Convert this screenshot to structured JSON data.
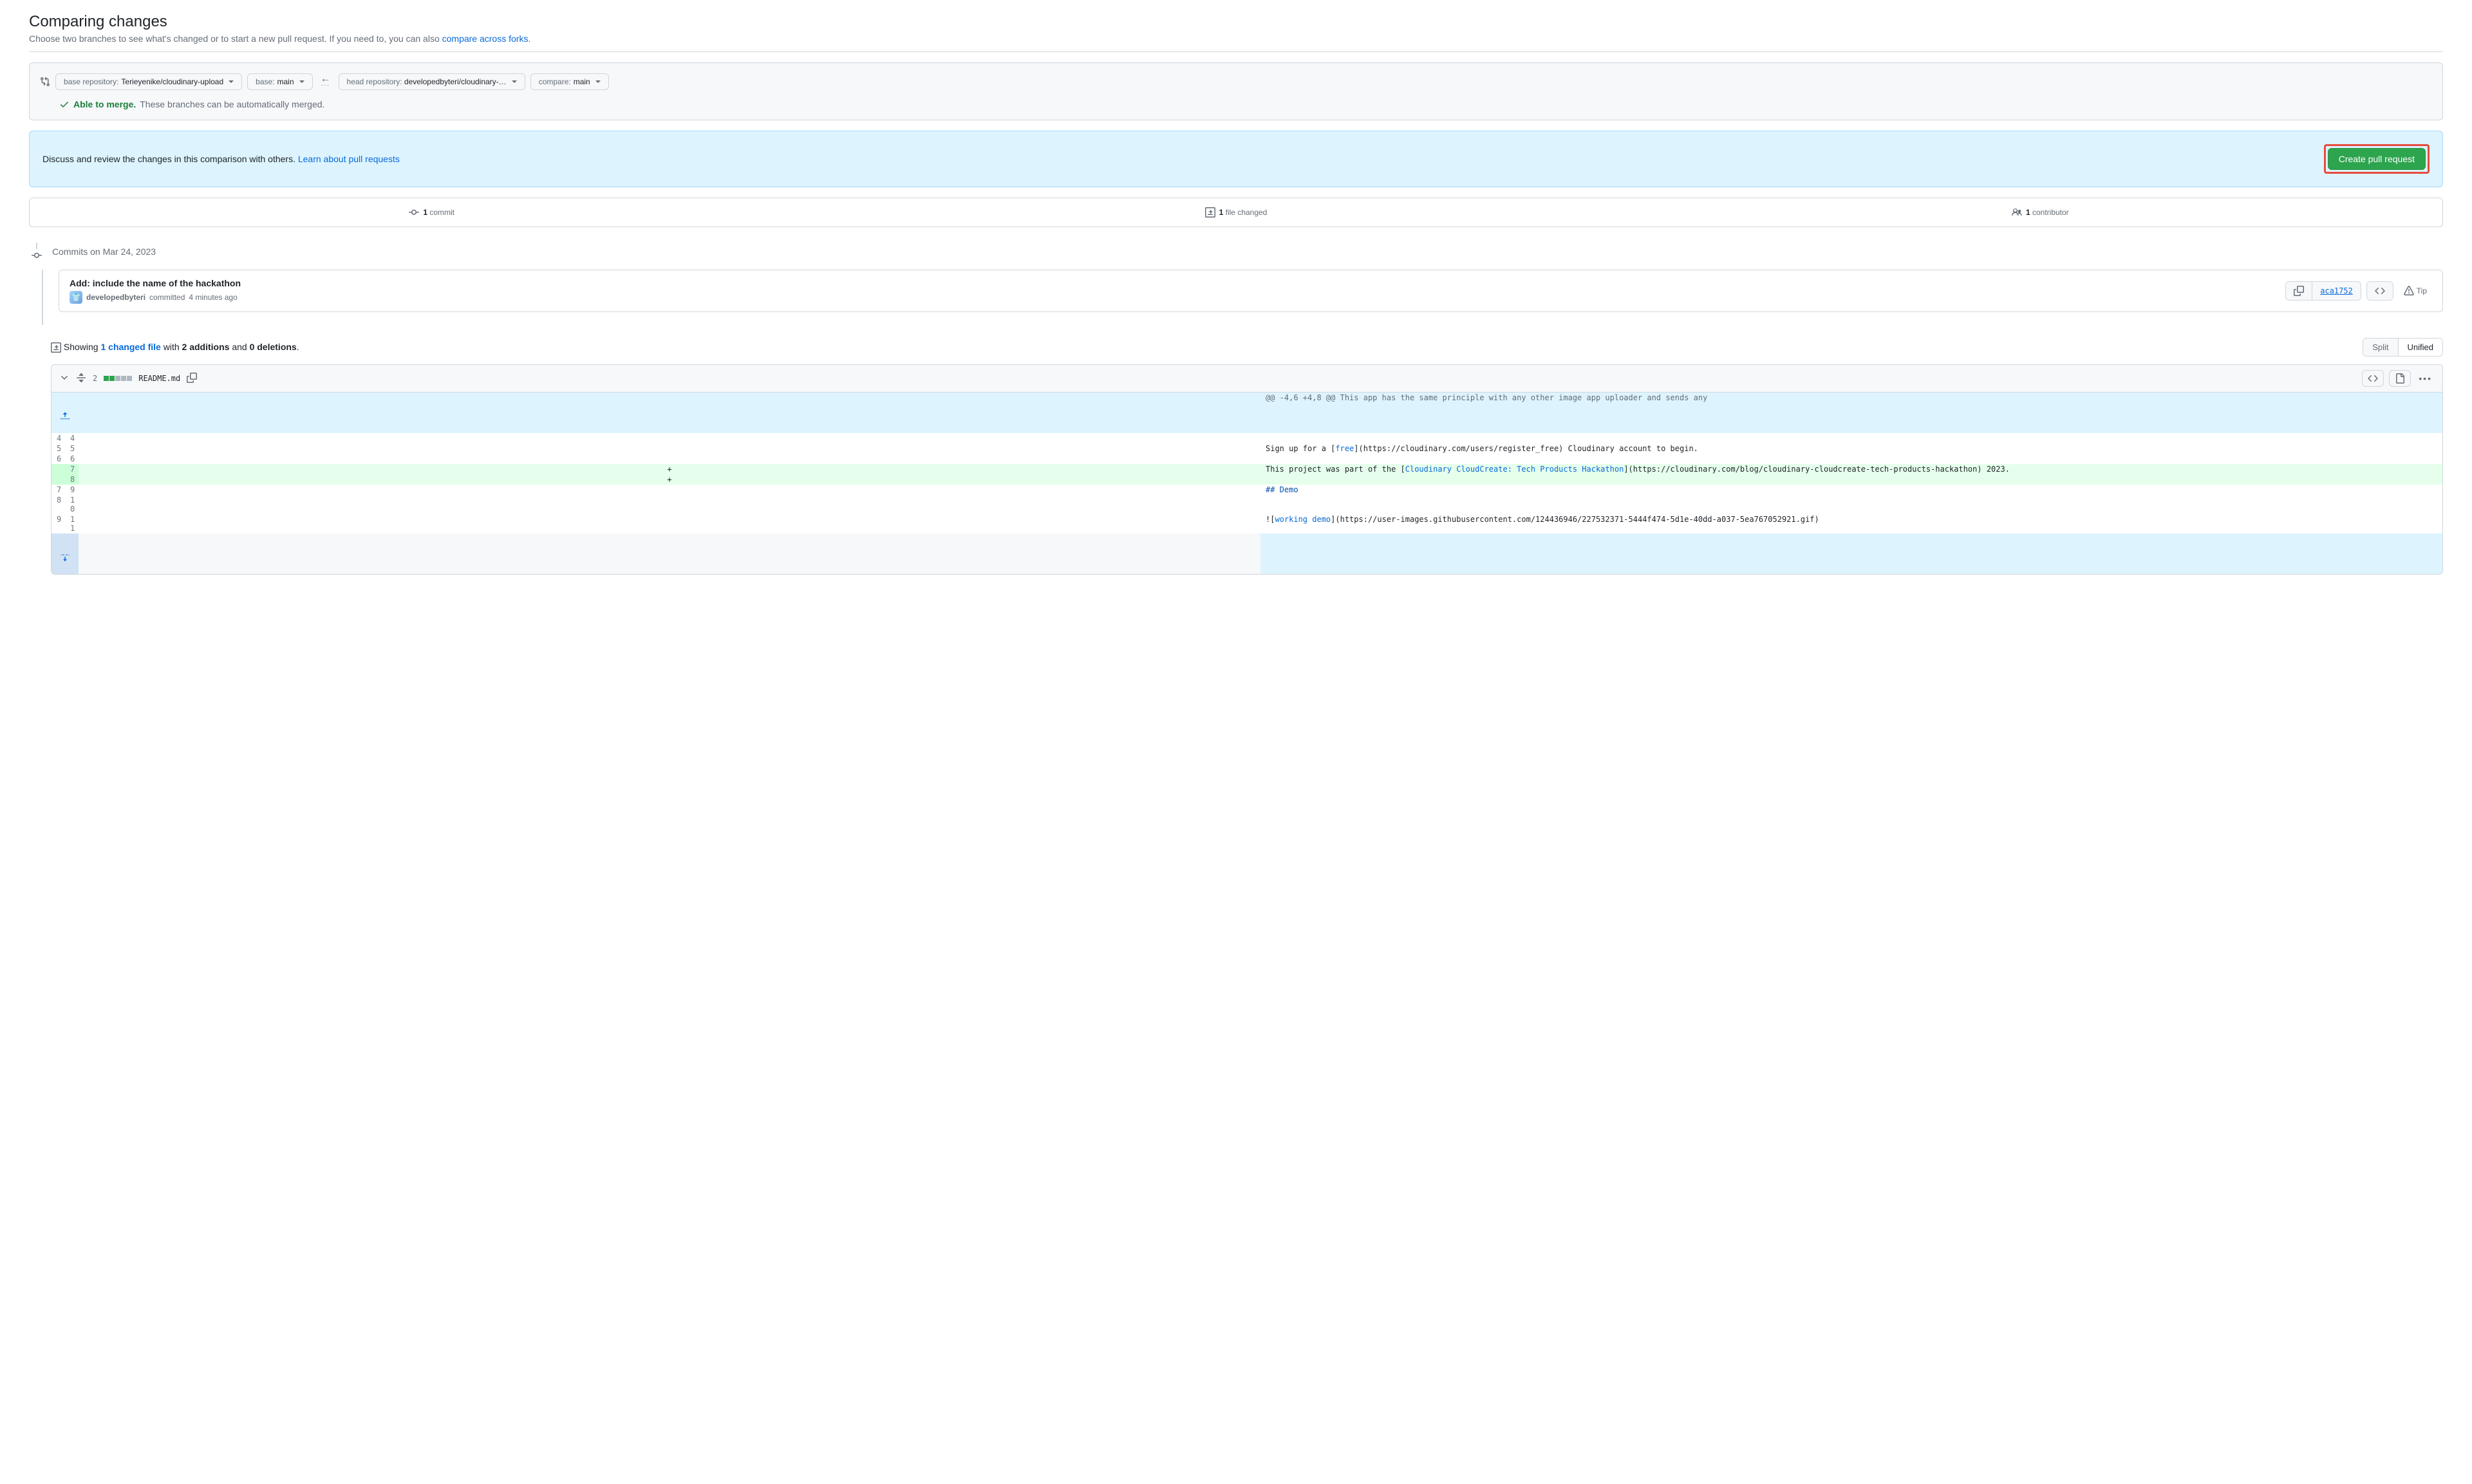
{
  "header": {
    "title": "Comparing changes",
    "subtitle_pre": "Choose two branches to see what's changed or to start a new pull request. If you need to, you can also ",
    "subtitle_link": "compare across forks",
    "subtitle_post": "."
  },
  "range": {
    "base_repo_label": "base repository: ",
    "base_repo_value": "Terieyenike/cloudinary-upload",
    "base_label": "base: ",
    "base_value": "main",
    "head_repo_label": "head repository: ",
    "head_repo_value": "developedbyteri/cloudinary-…",
    "compare_label": "compare: ",
    "compare_value": "main",
    "merge_strong": "Able to merge.",
    "merge_detail": "These branches can be automatically merged."
  },
  "flash": {
    "text": "Discuss and review the changes in this comparison with others. ",
    "link": "Learn about pull requests",
    "button": "Create pull request"
  },
  "stats": {
    "commits": {
      "count": "1",
      "label": "commit"
    },
    "files": {
      "count": "1",
      "label": "file changed"
    },
    "contributors": {
      "count": "1",
      "label": "contributor"
    }
  },
  "timeline": {
    "date_label": "Commits on Mar 24, 2023"
  },
  "commit": {
    "title": "Add: include the name of the hackathon",
    "author": "developedbyteri",
    "verb": "committed",
    "time": "4 minutes ago",
    "sha": "aca1752",
    "tip": "Tip"
  },
  "summary": {
    "pre": "Showing ",
    "link": "1 changed file",
    "mid1": " with ",
    "add": "2 additions",
    "mid2": " and ",
    "del": "0 deletions",
    "post": "."
  },
  "toggle": {
    "split": "Split",
    "unified": "Unified"
  },
  "file": {
    "count": "2",
    "name": "README.md"
  },
  "diff": {
    "hunk": "@@ -4,6 +4,8 @@ This app has the same principle with any other image app uploader and sends any",
    "row1_old": "4",
    "row1_new": "4",
    "row1_code": "",
    "row2_old": "5",
    "row2_new": "5",
    "row2_code_pre": "Sign up for a [",
    "row2_code_link": "free",
    "row2_code_post": "](https://cloudinary.com/users/register_free) Cloudinary account to begin.",
    "row3_old": "6",
    "row3_new": "6",
    "row3_code": "",
    "row4_new": "7",
    "row4_code_pre": "This project was part of the [",
    "row4_code_link": "Cloudinary CloudCreate: Tech Products Hackathon",
    "row4_code_post": "](https://cloudinary.com/blog/cloudinary-cloudcreate-tech-products-hackathon) 2023.",
    "row5_new": "8",
    "row5_code": "",
    "row6_old": "7",
    "row6_new": "9",
    "row6_code": "## Demo",
    "row7_old": "8",
    "row7_new": "10",
    "row7_code": "",
    "row8_old": "9",
    "row8_new": "11",
    "row8_code_pre": "![",
    "row8_code_link": "working demo",
    "row8_code_post": "](https://user-images.githubusercontent.com/124436946/227532371-5444f474-5d1e-40dd-a037-5ea767052921.gif)"
  }
}
